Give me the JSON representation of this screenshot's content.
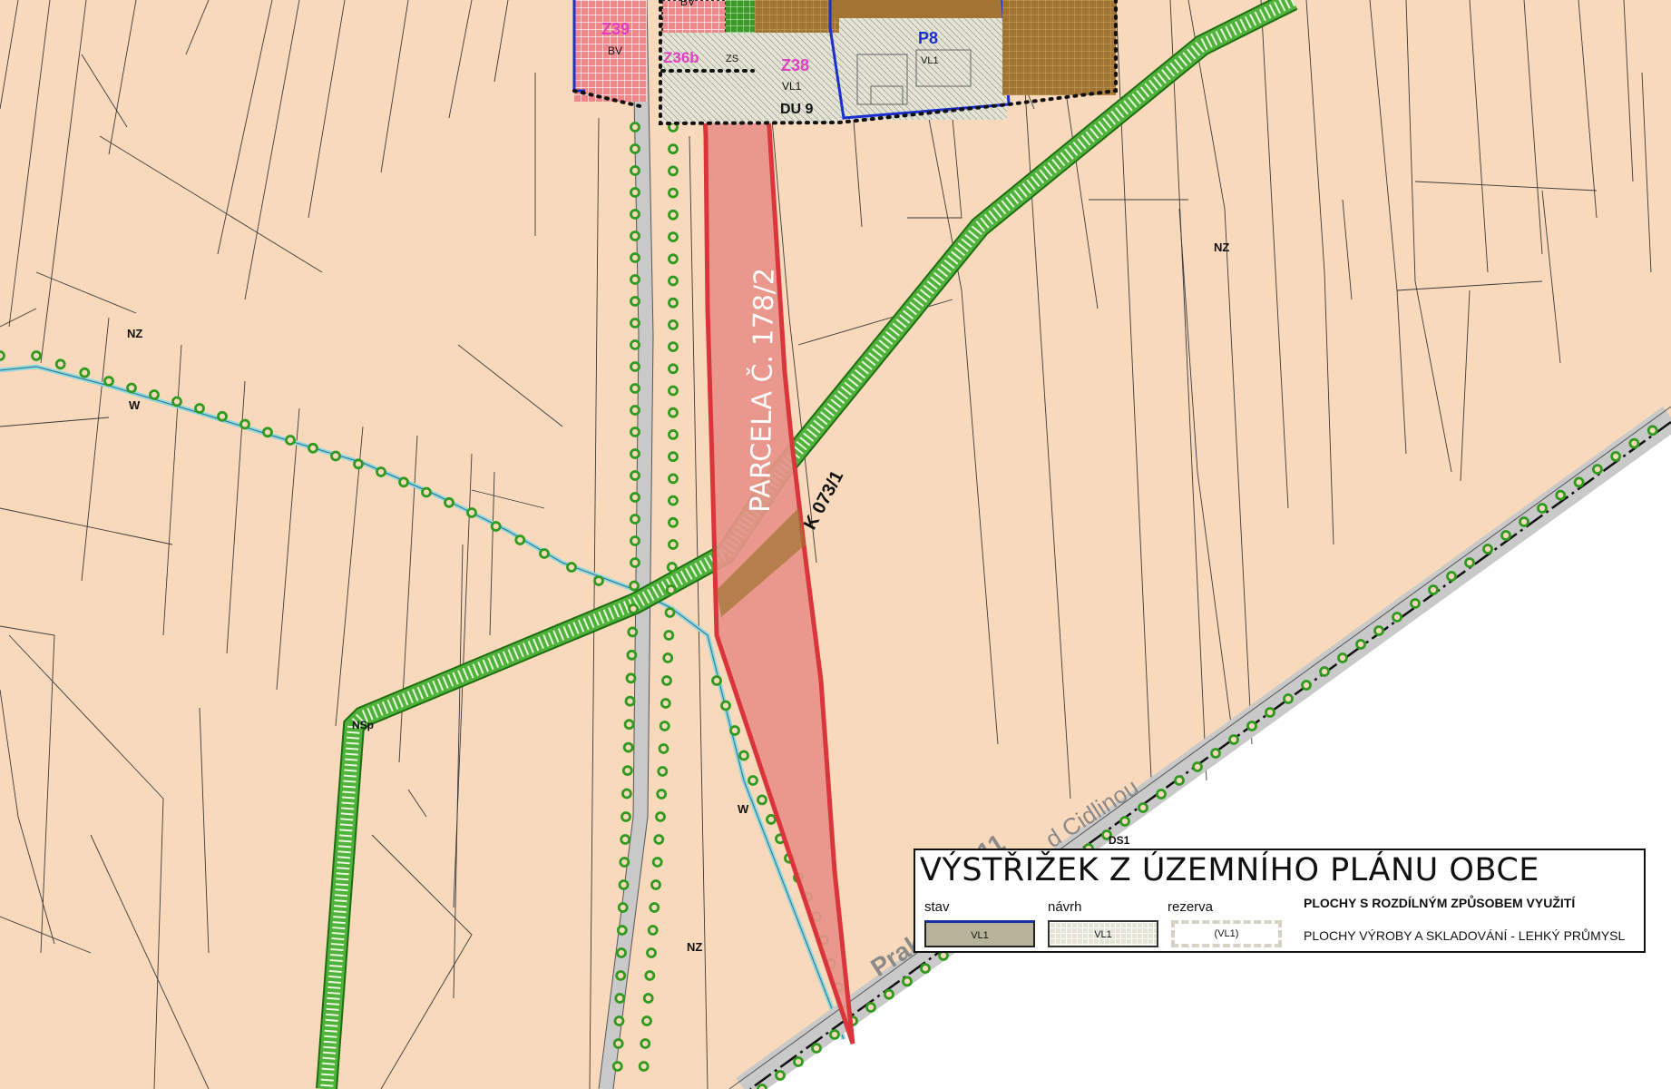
{
  "map": {
    "parcel_label": "PARCELA Č. 178/2",
    "corridor_label": "K 073/1",
    "road_label": "Prak",
    "road_number": "11",
    "road_label_2": "d Cidlinou",
    "zones": {
      "z39": "Z39",
      "z36b": "Z36b",
      "z38": "Z38",
      "p8": "P8",
      "du9": "DU 9",
      "bv_1": "BV",
      "bv_2": "BV",
      "zs": "ZS",
      "vl1_1": "VL1",
      "vl1_2": "VL1",
      "nz_1": "NZ",
      "nz_2": "NZ",
      "nz_3": "NZ",
      "w_1": "W",
      "w_2": "W",
      "nsp": "NSp",
      "ds1": "DS1"
    },
    "colors": {
      "background": "#f9d9bc",
      "parcel_fill": "#e8938a",
      "parcel_stroke": "#d9353a",
      "corridor": "#2f9a1e",
      "tree_dots": "#2f9a1e",
      "road": "#c9c9c9",
      "stream": "#8fd8dc",
      "industry_brown": "#a17432",
      "residential_red": "#f0878a",
      "blue_border": "#1a2fd0",
      "pink_label": "#e040c0"
    }
  },
  "legend": {
    "title": "VÝSTŘIŽEK Z ÚZEMNÍHO PLÁNU OBCE",
    "stav_label": "stav",
    "navrh_label": "návrh",
    "rezerva_label": "rezerva",
    "stav_code": "VL1",
    "navrh_code": "VL1",
    "rezerva_code": "(VL1)",
    "caption_heading": "PLOCHY S ROZDÍLNÝM ZPŮSOBEM VYUŽITÍ",
    "caption_text": "PLOCHY VÝROBY A SKLADOVÁNÍ - LEHKÝ PRŮMYSL"
  }
}
